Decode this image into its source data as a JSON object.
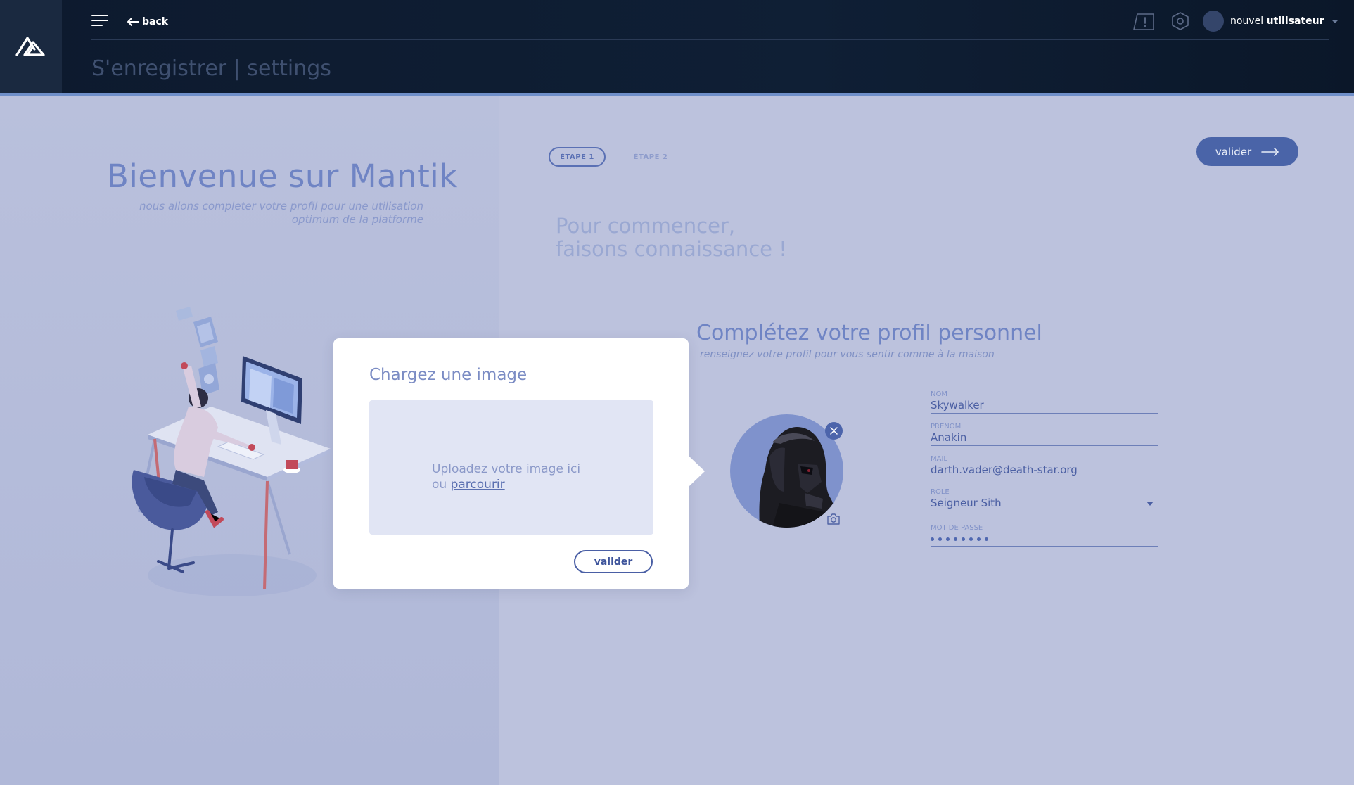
{
  "header": {
    "back_label": "back",
    "page_title": "S'enregistrer | settings",
    "user": {
      "prefix": "nouvel",
      "name": "utilisateur"
    },
    "icons": [
      "menu-icon",
      "back-arrow-icon",
      "alert-board-icon",
      "settings-hexagon-icon",
      "user-avatar",
      "caret-down-icon"
    ]
  },
  "welcome": {
    "title": "Bienvenue sur Mantik",
    "subtitle": "nous allons completer votre profil pour une utilisation optimum de la platforme"
  },
  "steps": {
    "step1": "ÉTAPE 1",
    "step2": "ÉTAPE 2"
  },
  "actions": {
    "valider_top": "valider"
  },
  "intro": {
    "line1": "Pour commencer,",
    "line2": "faisons connaissance !"
  },
  "profile": {
    "title": "Complétez votre profil personnel",
    "subtitle": "renseignez votre profil pour vous sentir comme à la maison",
    "fields": {
      "nom": {
        "label": "NOM",
        "value": "Skywalker"
      },
      "prenom": {
        "label": "PRENOM",
        "value": "Anakin"
      },
      "mail": {
        "label": "MAIL",
        "value": "darth.vader@death-star.org"
      },
      "role": {
        "label": "ROLE",
        "value": "Seigneur Sith"
      },
      "password": {
        "label": "MOT DE PASSE",
        "dots": 8
      }
    }
  },
  "modal": {
    "title": "Chargez une image",
    "dropzone_line1": "Uploadez votre image ici",
    "dropzone_prefix": "ou",
    "dropzone_link": "parcourir",
    "valider": "valider"
  },
  "colors": {
    "header_bg": "#0d1a2e",
    "accent": "#4a64a8",
    "page_bg": "#bcc2dd",
    "title_blue": "#6f84c4"
  }
}
